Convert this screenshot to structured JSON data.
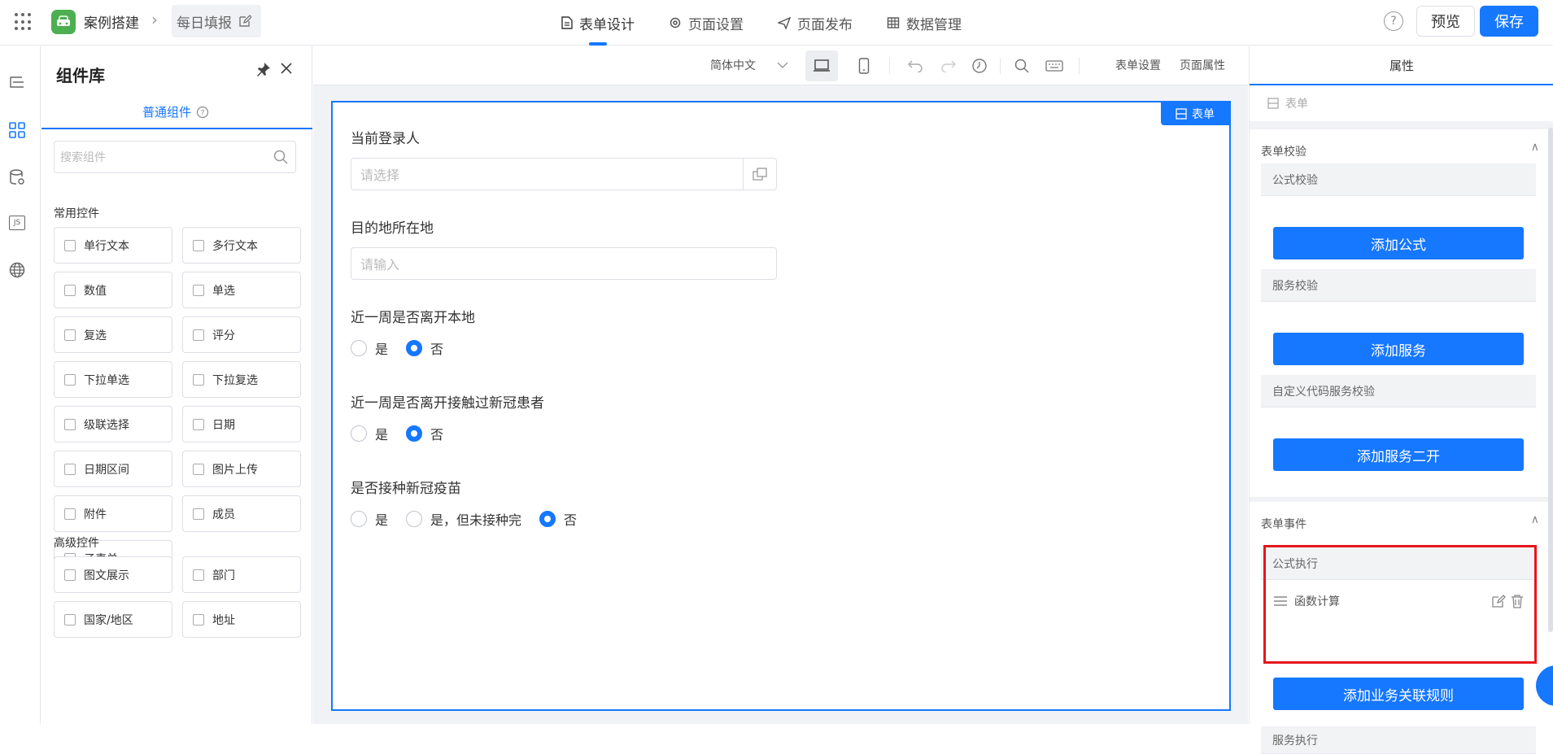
{
  "header": {
    "app_title": "案例搭建",
    "page_name": "每日填报",
    "tabs": [
      {
        "label": "表单设计",
        "icon": "document-icon"
      },
      {
        "label": "页面设置",
        "icon": "gear-icon"
      },
      {
        "label": "页面发布",
        "icon": "send-icon"
      },
      {
        "label": "数据管理",
        "icon": "table-icon"
      }
    ],
    "preview_label": "预览",
    "save_label": "保存",
    "help_glyph": "?"
  },
  "left_rail": {
    "icons": [
      "outline-icon",
      "components-icon",
      "datasource-icon",
      "js-icon",
      "globe-icon"
    ],
    "js_text": "JS"
  },
  "component_library": {
    "title": "组件库",
    "tab_label": "普通组件",
    "search_placeholder": "搜索组件",
    "common_title": "常用控件",
    "common_items": [
      "单行文本",
      "多行文本",
      "数值",
      "单选",
      "复选",
      "评分",
      "下拉单选",
      "下拉复选",
      "级联选择",
      "日期",
      "日期区间",
      "图片上传",
      "附件",
      "成员",
      "子表单"
    ],
    "advanced_title": "高级控件",
    "advanced_items": [
      "图文展示",
      "部门",
      "国家/地区",
      "地址"
    ]
  },
  "canvas": {
    "language": "简体中文",
    "form_settings": "表单设置",
    "page_props": "页面属性",
    "form_tag": "表单",
    "fields": [
      {
        "label": "当前登录人",
        "placeholder": "请选择"
      },
      {
        "label": "目的地所在地",
        "placeholder": "请输入"
      },
      {
        "label": "近一周是否离开本地",
        "options": [
          "是",
          "否"
        ],
        "selected": "否"
      },
      {
        "label": "近一周是否离开接触过新冠患者",
        "options": [
          "是",
          "否"
        ],
        "selected": "否"
      },
      {
        "label": "是否接种新冠疫苗",
        "options": [
          "是",
          "是，但未接种完",
          "否"
        ],
        "selected": "否"
      }
    ]
  },
  "properties": {
    "title": "属性",
    "breadcrumb": "表单",
    "validation_title": "表单校验",
    "formula_validation": "公式校验",
    "add_formula": "添加公式",
    "service_validation": "服务校验",
    "add_service": "添加服务",
    "custom_validation": "自定义代码服务校验",
    "add_service_dev": "添加服务二开",
    "events_title": "表单事件",
    "formula_exec": "公式执行",
    "rule_name": "函数计算",
    "add_rule": "添加业务关联规则",
    "service_exec": "服务执行",
    "collapse_glyph": "∧"
  },
  "colors": {
    "accent": "#1677ff",
    "highlight": "#e6161d",
    "logo": "#4caf50"
  }
}
